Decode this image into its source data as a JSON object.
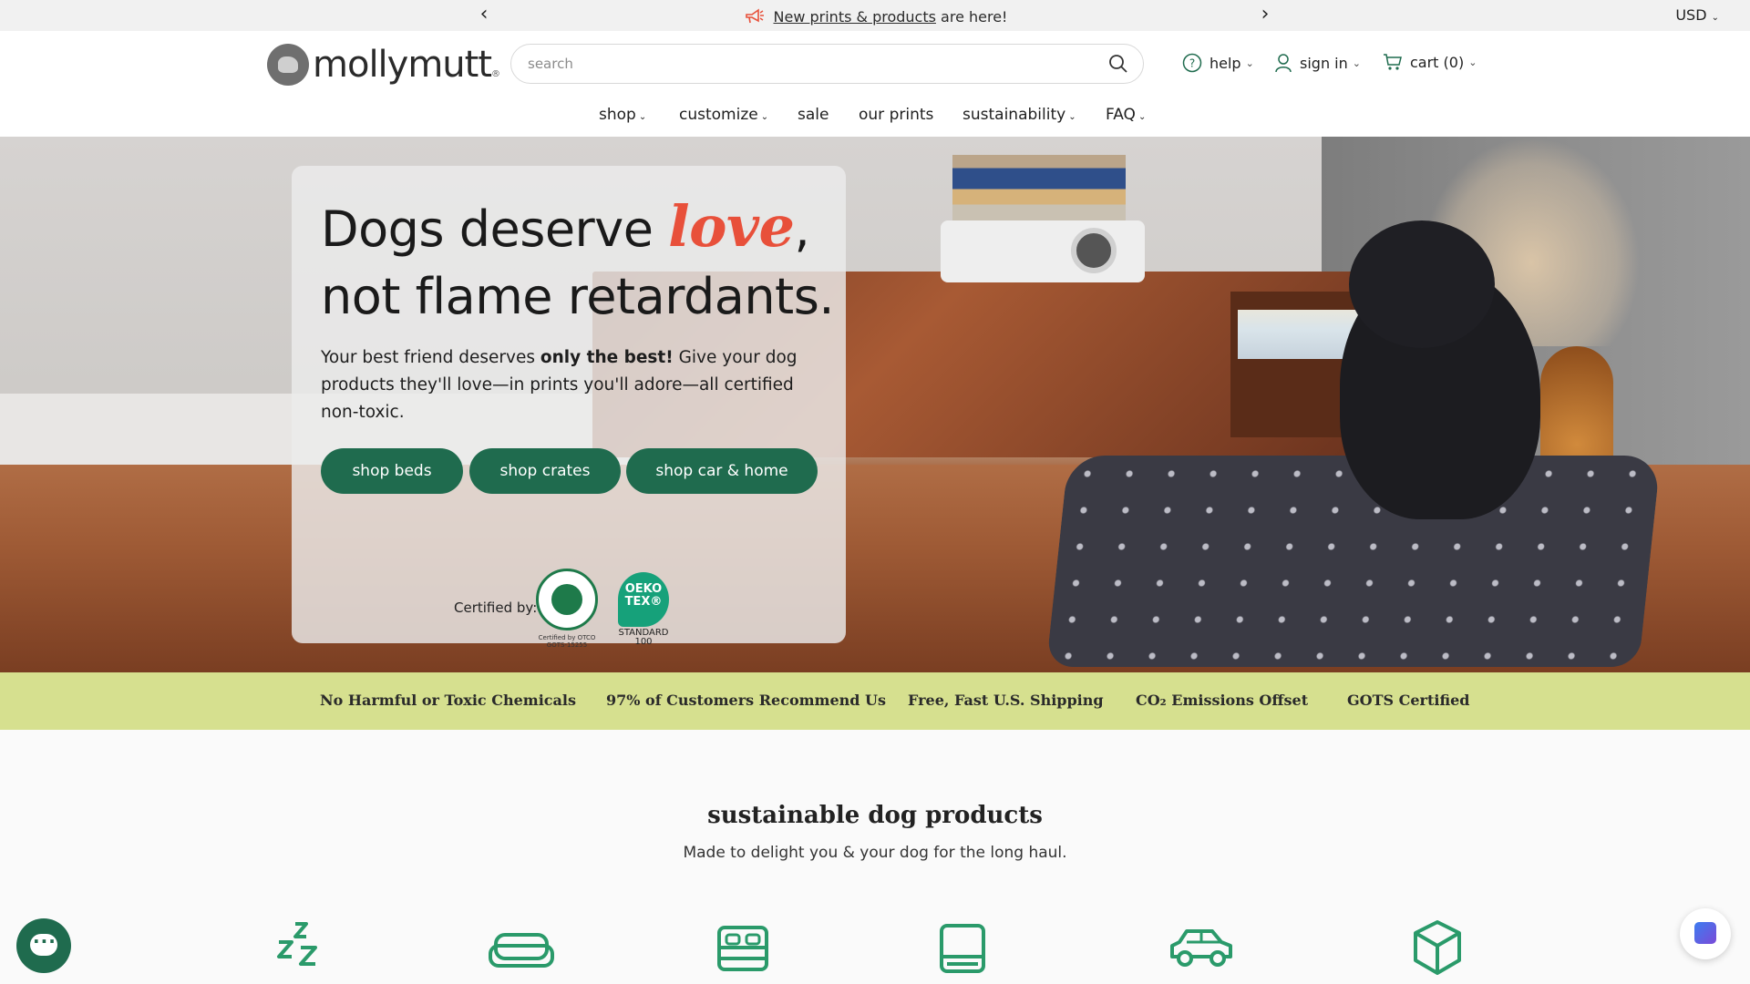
{
  "announcement": {
    "link_text": "New prints & products",
    "rest_text": " are here!",
    "prev": "‹",
    "next": "›",
    "currency": "USD"
  },
  "header": {
    "logo_text": "mollymutt",
    "logo_reg": "®",
    "search_placeholder": "search",
    "help": "help",
    "sign_in": "sign in",
    "cart": "cart (0)"
  },
  "nav": {
    "items": [
      {
        "label": "shop",
        "dropdown": true
      },
      {
        "label": "customize",
        "dropdown": true
      },
      {
        "label": "sale",
        "dropdown": false
      },
      {
        "label": "our prints",
        "dropdown": false
      },
      {
        "label": "sustainability",
        "dropdown": true
      },
      {
        "label": "FAQ",
        "dropdown": true
      }
    ]
  },
  "hero": {
    "title_part1": "Dogs deserve ",
    "title_love": "love",
    "title_part2": ", not flame retardants.",
    "sub_part1": "Your best friend deserves ",
    "sub_bold": "only the best!",
    "sub_part2": " Give your dog products they'll love—in prints you'll adore—all certified non-toxic.",
    "buttons": [
      "shop beds",
      "shop crates",
      "shop car & home"
    ],
    "certified_label": "Certified by:",
    "gots_caption": "Certified by OTCO GOTS-15255",
    "oeko_text": "OEKO TEX®",
    "oeko_caption": "STANDARD 100"
  },
  "value_props": [
    "No Harmful or Toxic Chemicals",
    "97% of Customers Recommend Us",
    "Free, Fast U.S. Shipping",
    "CO₂ Emissions Offset",
    "GOTS Certified"
  ],
  "section": {
    "title": "sustainable dog products",
    "subtitle": "Made to delight you & your dog for the long haul."
  },
  "colors": {
    "brand_green": "#1f6b4e",
    "value_bar": "#d6e08f",
    "love_accent": "#e8503a",
    "icon_green": "#2a9a6a"
  },
  "icons": [
    "sleep-zzz-icon",
    "sofa-icon",
    "bed-icon",
    "mat-icon",
    "car-icon",
    "box-icon"
  ]
}
